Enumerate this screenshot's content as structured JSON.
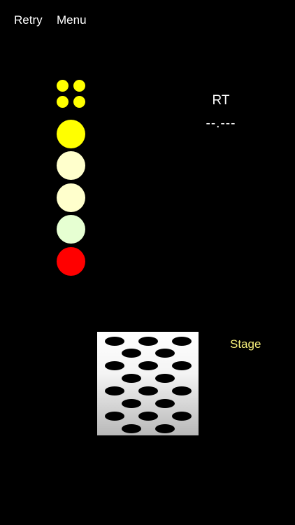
{
  "nav": {
    "retry_label": "Retry",
    "menu_label": "Menu"
  },
  "reaction_time": {
    "label": "RT",
    "value": "--.---"
  },
  "stage": {
    "label": "Stage"
  },
  "colors": {
    "background": "#000000",
    "nav_text": "#ffffff",
    "stage_label": "#f5ee7a",
    "mini_lights": "#ffff00",
    "lights": [
      "#ffff00",
      "#ffffcc",
      "#ffffcc",
      "#e6ffd2",
      "#ff0000"
    ]
  },
  "stage_pattern": {
    "rows": 8,
    "holes": 21
  }
}
